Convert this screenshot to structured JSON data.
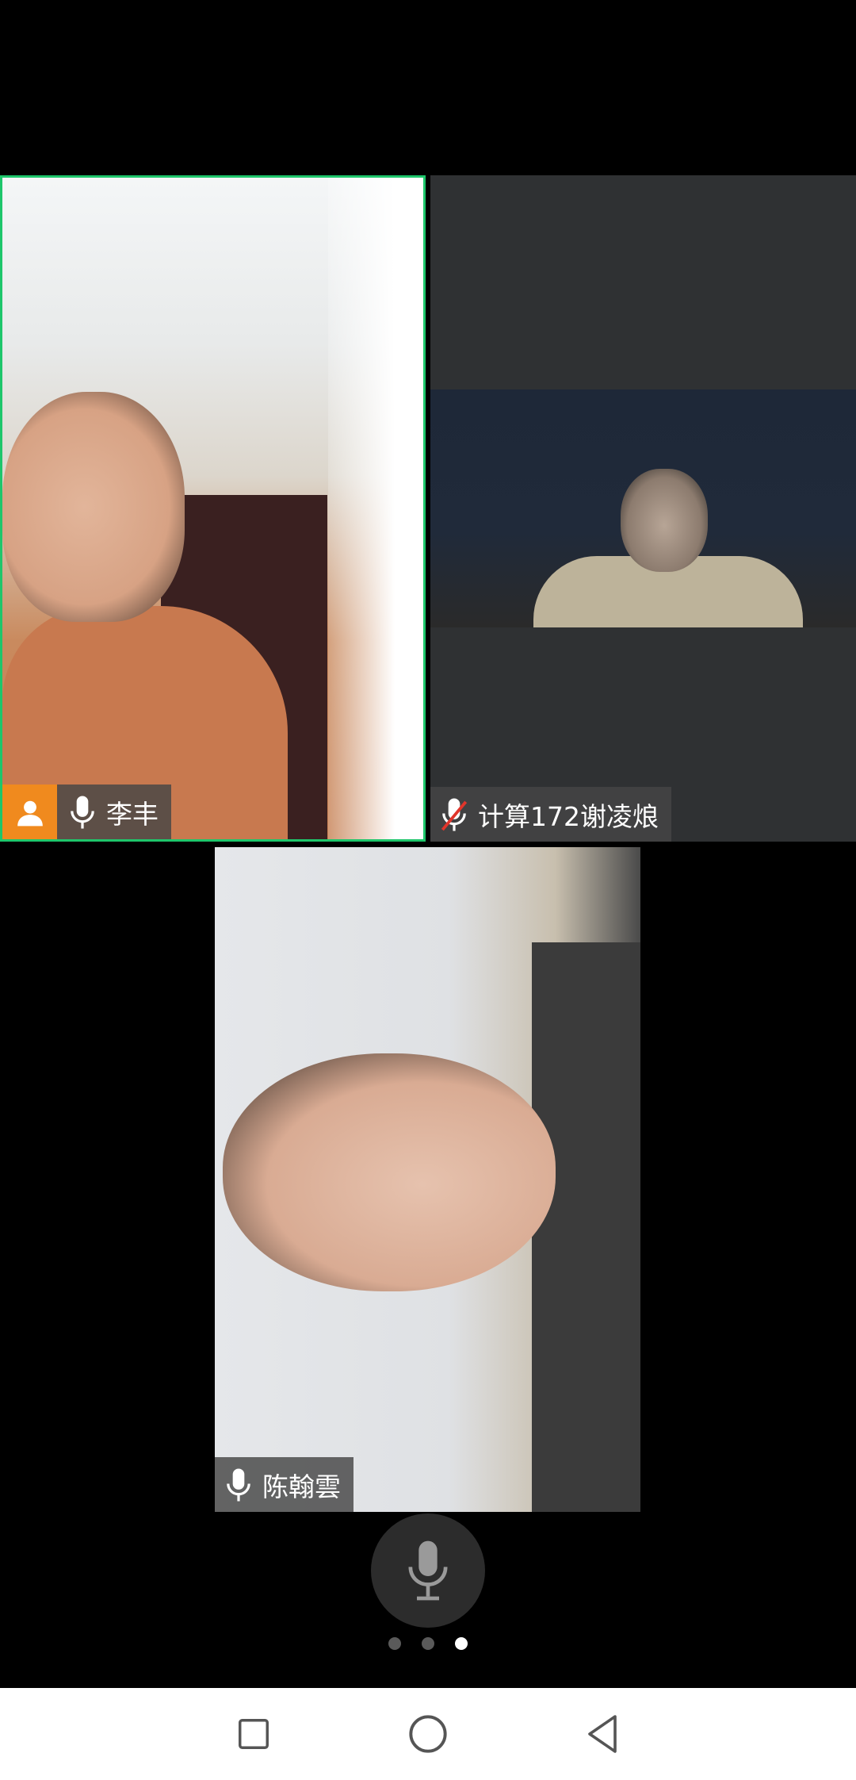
{
  "participants": [
    {
      "name": "李丰",
      "is_host": true,
      "muted": false,
      "active_speaker": true
    },
    {
      "name": "计算172谢凌烺",
      "is_host": false,
      "muted": true,
      "active_speaker": false
    },
    {
      "name": "陈翰雲",
      "is_host": false,
      "muted": false,
      "active_speaker": false
    }
  ],
  "pagination": {
    "pages": 3,
    "current": 3
  },
  "colors": {
    "active_border": "#1ec66b",
    "host_badge": "#f08a1e",
    "muted_slash": "#e0352b"
  },
  "nav_icons": [
    "recents-square-icon",
    "home-circle-icon",
    "back-triangle-icon"
  ]
}
